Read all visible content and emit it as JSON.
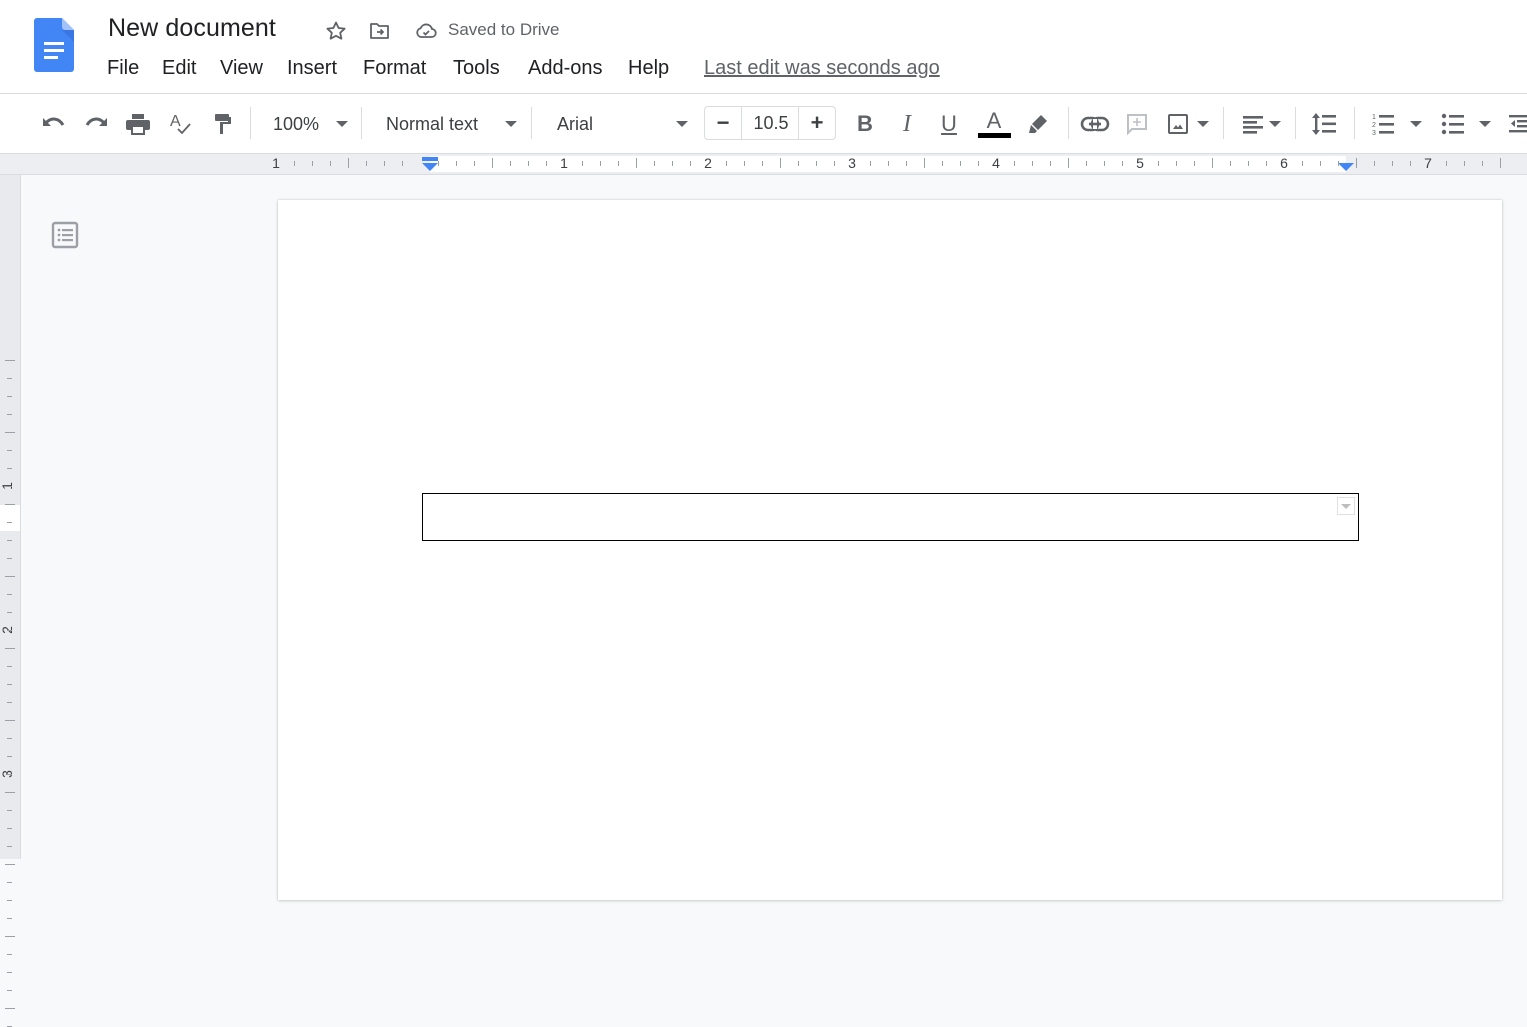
{
  "header": {
    "doc_title": "New document",
    "star_icon": "star-icon",
    "move_icon": "move-to-folder-icon",
    "cloud_icon": "cloud-done-icon",
    "saved_status": "Saved to Drive",
    "last_edit": "Last edit was seconds ago",
    "brand_color": "#4285f4"
  },
  "menu": {
    "items": [
      {
        "label": "File"
      },
      {
        "label": "Edit"
      },
      {
        "label": "View"
      },
      {
        "label": "Insert"
      },
      {
        "label": "Format"
      },
      {
        "label": "Tools"
      },
      {
        "label": "Add-ons"
      },
      {
        "label": "Help"
      }
    ]
  },
  "toolbar": {
    "zoom": "100%",
    "style": "Normal text",
    "font": "Arial",
    "font_size": "10.5",
    "minus": "−",
    "plus": "+",
    "bold": "B",
    "italic": "I",
    "underline": "U",
    "text_color_glyph": "A",
    "text_color": "#000000",
    "icons": [
      "undo-icon",
      "redo-icon",
      "print-icon",
      "spellcheck-icon",
      "paint-format-icon",
      "bold-icon",
      "italic-icon",
      "underline-icon",
      "text-color-icon",
      "highlight-icon",
      "link-icon",
      "add-comment-icon",
      "insert-image-icon",
      "align-left-icon",
      "line-spacing-icon",
      "numbered-list-icon",
      "bulleted-list-icon",
      "decrease-indent-icon"
    ]
  },
  "ruler": {
    "horizontal_labels": [
      "1",
      "1",
      "2",
      "3",
      "4",
      "5",
      "6",
      "7"
    ],
    "vertical_labels": [
      "1",
      "2",
      "3"
    ],
    "accent_color": "#4285f4"
  },
  "document": {
    "outline_icon": "document-outline-icon",
    "dropdown_value": ""
  }
}
